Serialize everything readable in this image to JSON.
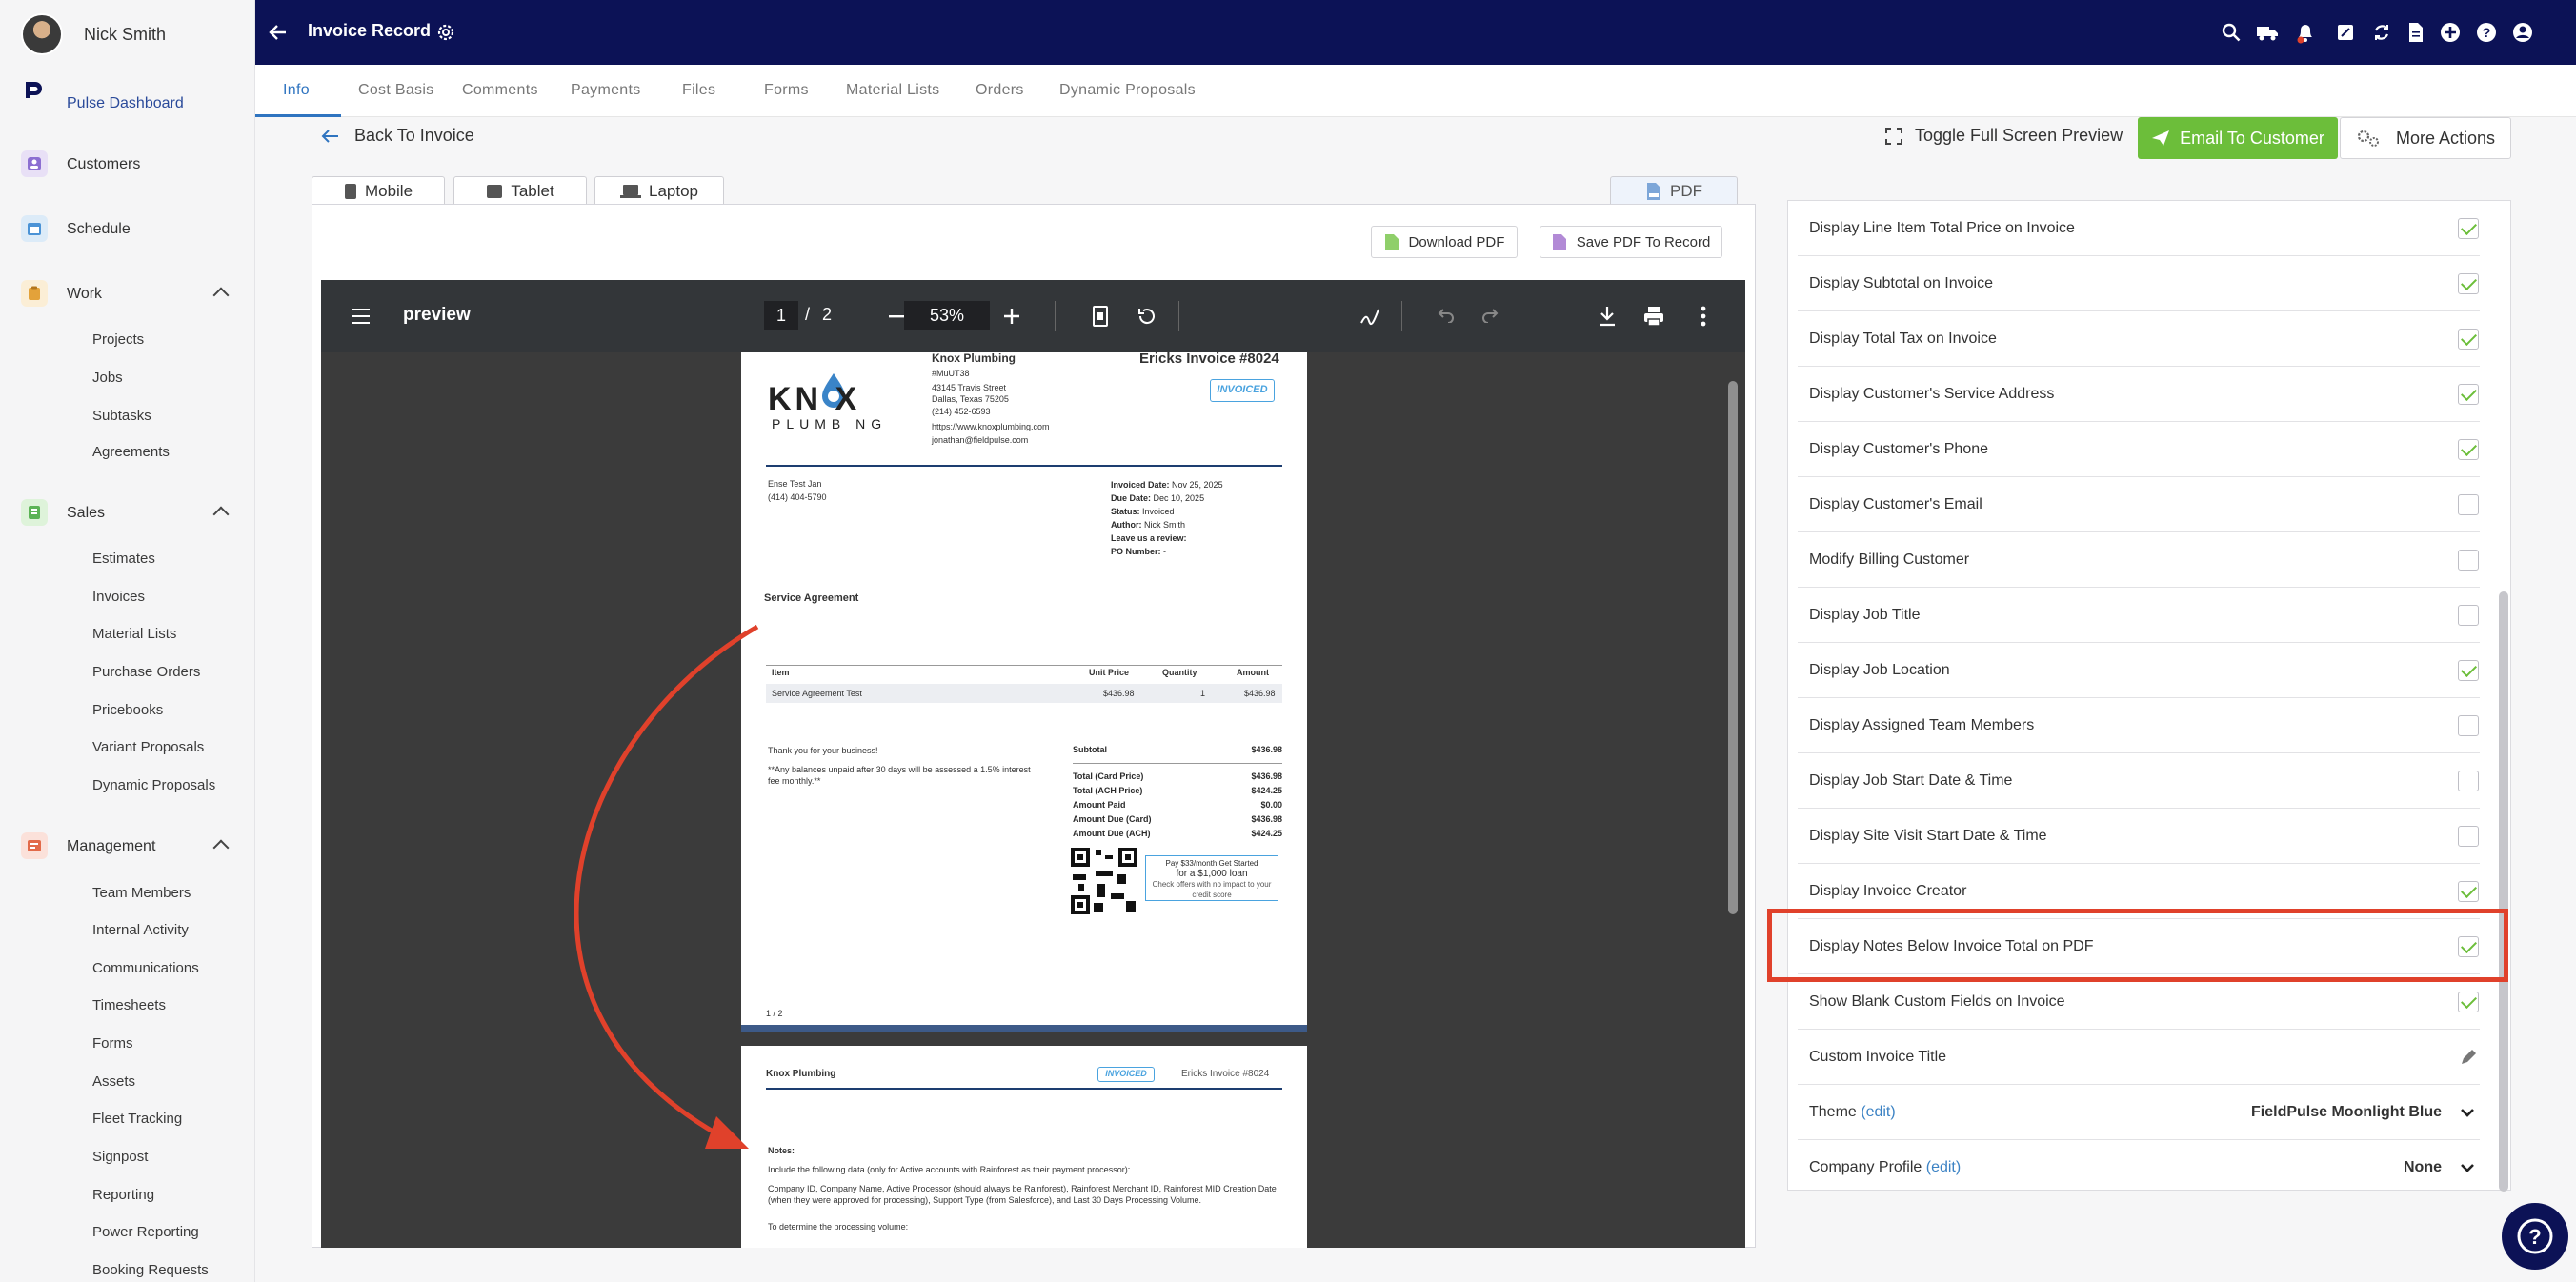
{
  "user": {
    "name": "Nick Smith"
  },
  "sidebar": {
    "items": [
      {
        "label": "Pulse Dashboard",
        "icon": "pulse-logo-icon",
        "active": true
      },
      {
        "label": "Customers",
        "icon": "customers-icon"
      },
      {
        "label": "Schedule",
        "icon": "calendar-icon"
      },
      {
        "label": "Work",
        "icon": "work-icon"
      },
      {
        "label": "Sales",
        "icon": "sales-icon"
      },
      {
        "label": "Management",
        "icon": "management-icon"
      }
    ],
    "work_sub": [
      "Projects",
      "Jobs",
      "Subtasks",
      "Agreements"
    ],
    "sales_sub": [
      "Estimates",
      "Invoices",
      "Material Lists",
      "Purchase Orders",
      "Pricebooks",
      "Variant Proposals",
      "Dynamic Proposals"
    ],
    "management_sub": [
      "Team Members",
      "Internal Activity",
      "Communications",
      "Timesheets",
      "Forms",
      "Assets",
      "Fleet Tracking",
      "Signpost",
      "Reporting",
      "Power Reporting",
      "Booking Requests"
    ]
  },
  "header": {
    "title": "Invoice Record"
  },
  "tabs": [
    "Info",
    "Cost Basis",
    "Comments",
    "Payments",
    "Files",
    "Forms",
    "Material Lists",
    "Orders",
    "Dynamic Proposals"
  ],
  "actions": {
    "back": "Back To Invoice",
    "toggle": "Toggle Full Screen Preview",
    "email": "Email To Customer",
    "more": "More Actions"
  },
  "devices": {
    "mobile": "Mobile",
    "tablet": "Tablet",
    "laptop": "Laptop",
    "pdf": "PDF"
  },
  "pdf_buttons": {
    "download": "Download PDF",
    "save": "Save PDF To Record"
  },
  "viewer": {
    "name": "preview",
    "page": "1",
    "total": "2",
    "zoom": "53%"
  },
  "invoice": {
    "company": "Knox Plumbing",
    "logo_text": "KN  X",
    "logo_sub": "PLUMB NG",
    "number": "Ericks Invoice #8024",
    "status_badge": "INVOICED",
    "address": [
      "#MuUT38",
      "43145 Travis Street",
      "Dallas, Texas 75205",
      "(214) 452-6593",
      "https://www.knoxplumbing.com",
      "jonathan@fieldpulse.com"
    ],
    "customer": [
      "Ense Test Jan",
      "(414) 404-5790"
    ],
    "meta": [
      {
        "k": "Invoiced Date:",
        "v": "Nov 25, 2025"
      },
      {
        "k": "Due Date:",
        "v": "Dec 10, 2025"
      },
      {
        "k": "Status:",
        "v": "Invoiced"
      },
      {
        "k": "Author:",
        "v": "Nick Smith"
      },
      {
        "k": "Leave us a review:",
        "v": ""
      },
      {
        "k": "PO Number:",
        "v": "-"
      }
    ],
    "section": "Service Agreement",
    "table_headers": [
      "Item",
      "Unit Price",
      "Quantity",
      "Amount"
    ],
    "table_row": [
      "Service Agreement Test",
      "$436.98",
      "1",
      "$436.98"
    ],
    "thanks": "Thank you for your business!",
    "terms": "**Any balances unpaid after 30 days will be assessed a 1.5% interest fee monthly.**",
    "totals": [
      {
        "k": "Subtotal",
        "v": "$436.98"
      },
      {
        "k": "Total (Card Price)",
        "v": "$436.98"
      },
      {
        "k": "Total (ACH Price)",
        "v": "$424.25"
      },
      {
        "k": "Amount Paid",
        "v": "$0.00"
      },
      {
        "k": "Amount Due (Card)",
        "v": "$436.98"
      },
      {
        "k": "Amount Due (ACH)",
        "v": "$424.25"
      }
    ],
    "loan_line1": "Pay $33/month Get Started",
    "loan_line2": "for a $1,000 loan",
    "loan_line3": "Check offers with no impact to your credit score",
    "page_footer": "1 / 2",
    "p2_company": "Knox Plumbing",
    "p2_number": "Ericks Invoice #8024",
    "notes_title": "Notes:",
    "notes_1": "Include the following data (only for Active accounts with Rainforest as their payment processor):",
    "notes_2": "Company ID, Company Name, Active Processor (should always be Rainforest), Rainforest Merchant ID, Rainforest MID Creation Date (when they were approved for processing), Support Type (from Salesforce), and Last 30 Days Processing Volume.",
    "notes_3": "To determine the processing volume:"
  },
  "settings": [
    {
      "label": "Display Line Item Total Price on Invoice",
      "checked": true
    },
    {
      "label": "Display Subtotal on Invoice",
      "checked": true
    },
    {
      "label": "Display Total Tax on Invoice",
      "checked": true
    },
    {
      "label": "Display Customer's Service Address",
      "checked": true
    },
    {
      "label": "Display Customer's Phone",
      "checked": true
    },
    {
      "label": "Display Customer's Email",
      "checked": false
    },
    {
      "label": "Modify Billing Customer",
      "checked": false
    },
    {
      "label": "Display Job Title",
      "checked": false
    },
    {
      "label": "Display Job Location",
      "checked": true
    },
    {
      "label": "Display Assigned Team Members",
      "checked": false
    },
    {
      "label": "Display Job Start Date & Time",
      "checked": false
    },
    {
      "label": "Display Site Visit Start Date & Time",
      "checked": false
    },
    {
      "label": "Display Invoice Creator",
      "checked": true
    },
    {
      "label": "Display Notes Below Invoice Total on PDF",
      "checked": true
    },
    {
      "label": "Show Blank Custom Fields on Invoice",
      "checked": true
    }
  ],
  "custom_title": "Custom Invoice Title",
  "theme": {
    "label": "Theme",
    "edit": "(edit)",
    "value": "FieldPulse Moonlight Blue"
  },
  "company_profile": {
    "label": "Company Profile",
    "edit": "(edit)",
    "value": "None"
  },
  "colors": {
    "navy": "#0c1256",
    "accent": "#2f74c0",
    "green": "#6cbe3a",
    "highlight": "#e0412b"
  }
}
